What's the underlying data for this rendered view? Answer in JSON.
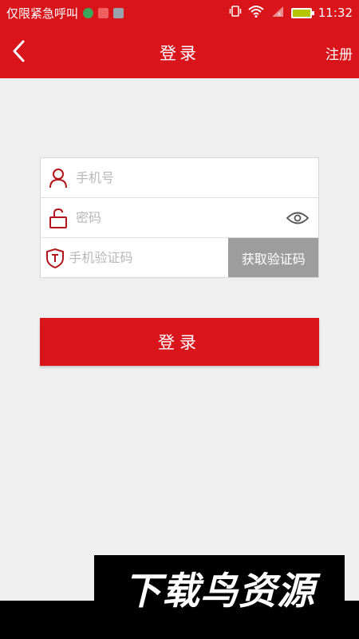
{
  "status_bar": {
    "left_text": "仅限紧急呼叫",
    "icons": [
      "app-icon-green",
      "app-icon-red",
      "app-icon-gray"
    ],
    "time": "11:32",
    "indicators": [
      "vibrate-icon",
      "wifi-icon",
      "signal-icon",
      "battery-icon"
    ]
  },
  "header": {
    "title": "登录",
    "register_label": "注册",
    "back_icon": "chevron-left-icon"
  },
  "form": {
    "phone_placeholder": "手机号",
    "password_placeholder": "密码",
    "code_placeholder": "手机验证码",
    "get_code_label": "获取验证码"
  },
  "login_label": "登录",
  "watermark_text": "下载鸟资源",
  "colors": {
    "brand_red": "#d9141b",
    "background": "#efefef",
    "code_button": "#9d9d9d"
  }
}
